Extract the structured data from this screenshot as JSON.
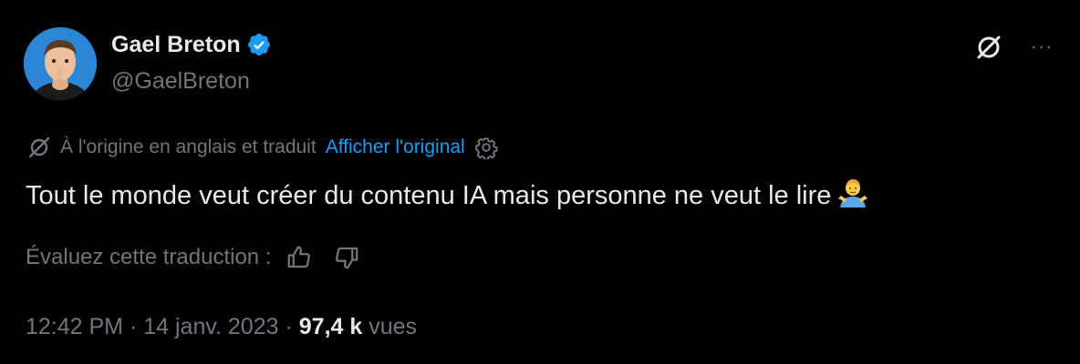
{
  "author": {
    "display_name": "Gael Breton",
    "handle": "@GaelBreton",
    "verified": true
  },
  "header_actions": {
    "grok_icon": "grok-icon",
    "more_icon": "more-options-icon",
    "more_glyph": "···"
  },
  "translation": {
    "notice": "À l'origine en anglais et traduit",
    "show_original": "Afficher l'original",
    "settings_icon": "gear-icon"
  },
  "tweet": {
    "text": "Tout le monde veut créer du contenu IA mais personne ne veut le lire",
    "emoji": "person-shrugging-emoji"
  },
  "rating": {
    "label": "Évaluez cette traduction :",
    "like_icon": "thumbs-up-icon",
    "dislike_icon": "thumbs-down-icon"
  },
  "meta": {
    "time": "12:42 PM",
    "separator": "·",
    "date": "14 janv. 2023",
    "views_count": "97,4 k",
    "views_label": "vues"
  },
  "colors": {
    "background": "#000000",
    "text_primary": "#e7e9ea",
    "text_secondary": "#71767b",
    "link": "#1d9bf0",
    "verified": "#1d9bf0"
  }
}
